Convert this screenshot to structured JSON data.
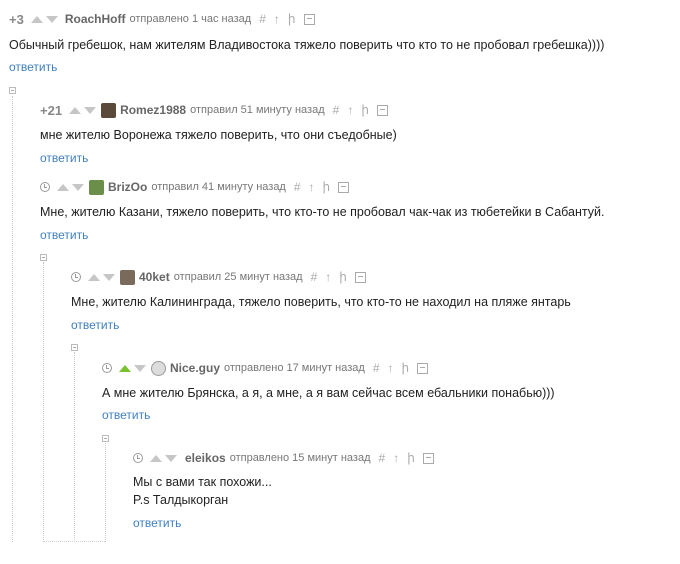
{
  "colors": {
    "link": "#3f7fbf",
    "upvote_active": "#79c12f",
    "arrow_inactive": "#c6c6c6"
  },
  "icons": [
    "clock-icon",
    "upvote-icon",
    "downvote-icon",
    "hash-icon",
    "arrow-up-icon",
    "branch-icon",
    "save-icon",
    "collapse-icon"
  ],
  "tools": {
    "hash": "#",
    "up": "↑",
    "branch": "ի"
  },
  "comments": [
    {
      "rating": "+3",
      "author": "RoachHoff",
      "meta": "отправлено 1 час назад",
      "text": "Обычный гребешок, нам жителям Владивостока тяжело поверить что кто то не пробовал гребешка))))",
      "reply": "ответить"
    },
    {
      "rating": "+21",
      "author": "Romez1988",
      "meta": "отправил 51 минуту назад",
      "text": "мне жителю Воронежа тяжело поверить, что они съедобные)",
      "reply": "ответить"
    },
    {
      "author": "BrizOo",
      "meta": "отправил 41 минуту назад",
      "text": "Мне, жителю Казани, тяжело поверить, что кто-то не пробовал чак-чак из тюбетейки в Сабантуй.",
      "reply": "ответить"
    },
    {
      "author": "40ket",
      "meta": "отправил 25 минут назад",
      "text": "Мне, жителю Калининграда, тяжело поверить, что кто-то не находил на пляже янтарь",
      "reply": "ответить"
    },
    {
      "author": "Nice.guy",
      "meta": "отправлено 17 минут назад",
      "text": "А мне жителю Брянска, а я, а мне, а я вам сейчас всем ебальники понабью)))",
      "reply": "ответить"
    },
    {
      "author": "eleikos",
      "meta": "отправлено 15 минут назад",
      "text": "Мы с вами так похожи...",
      "text2": "P.s Талдыкорган",
      "reply": "ответить"
    }
  ]
}
